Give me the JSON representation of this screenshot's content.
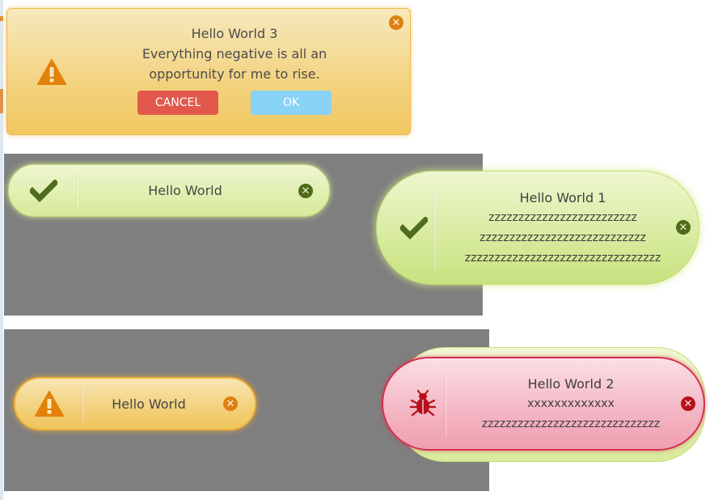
{
  "colors": {
    "warning_bg": "#f3d27f",
    "warning_icon": "#e2810b",
    "success_bg": "#d6ea9a",
    "success_icon": "#4f6d1c",
    "error_bg": "#f4b5c3",
    "error_icon": "#b5111b",
    "cancel_button": "#e2584c",
    "ok_button": "#89d3f6",
    "panel_bg": "#7f7f7f"
  },
  "warning_card": {
    "icon": "warning-triangle-icon",
    "title": "Hello World 3",
    "message_line1": "Everything negative is all an",
    "message_line2": "opportunity for me to rise.",
    "cancel_label": "CANCEL",
    "ok_label": "OK",
    "close_icon": "close-icon"
  },
  "success_small": {
    "icon": "checkmark-icon",
    "text": "Hello World",
    "close_icon": "close-icon"
  },
  "success_large": {
    "icon": "checkmark-icon",
    "title": "Hello World 1",
    "line1": "zzzzzzzzzzzzzzzzzzzzzzzzz",
    "line2": "zzzzzzzzzzzzzzzzzzzzzzzzzzzz",
    "line3": "zzzzzzzzzzzzzzzzzzzzzzzzzzzzzzzzz",
    "close_icon": "close-icon"
  },
  "warning_small": {
    "icon": "warning-triangle-icon",
    "text": "Hello World",
    "close_icon": "close-icon"
  },
  "error_large": {
    "icon": "bug-icon",
    "title": "Hello World 2",
    "line1": "xxxxxxxxxxxxx",
    "line2": "zzzzzzzzzzzzzzzzzzzzzzzzzzzzzz",
    "close_icon": "close-icon"
  }
}
